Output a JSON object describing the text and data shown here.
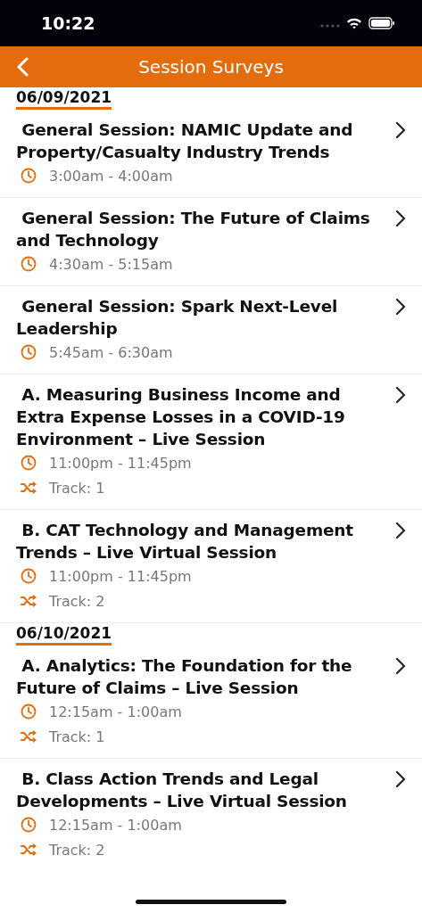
{
  "status_bar": {
    "time": "10:22"
  },
  "nav_bar": {
    "title": "Session Surveys"
  },
  "days": [
    {
      "date": "06/09/2021",
      "sessions": [
        {
          "title": " General Session: NAMIC Update and Property/Casualty Industry Trends",
          "time": "3:00am - 4:00am"
        },
        {
          "title": " General Session: The Future of Claims and Technology",
          "time": "4:30am - 5:15am"
        },
        {
          "title": " General Session: Spark Next-Level Leadership",
          "time": "5:45am - 6:30am"
        },
        {
          "title": " A. Measuring Business Income and Extra Expense Losses in a COVID-19 Environment – Live Session",
          "time": "11:00pm - 11:45pm",
          "track": "Track: 1"
        },
        {
          "title": " B. CAT Technology and Management Trends – Live Virtual Session",
          "time": "11:00pm - 11:45pm",
          "track": "Track: 2"
        }
      ]
    },
    {
      "date": "06/10/2021",
      "sessions": [
        {
          "title": " A. Analytics: The Foundation for the Future of Claims – Live Session",
          "time": "12:15am - 1:00am",
          "track": "Track: 1"
        },
        {
          "title": " B. Class Action Trends and Legal Developments – Live Virtual Session",
          "time": "12:15am - 1:00am",
          "track": "Track: 2"
        }
      ]
    }
  ]
}
